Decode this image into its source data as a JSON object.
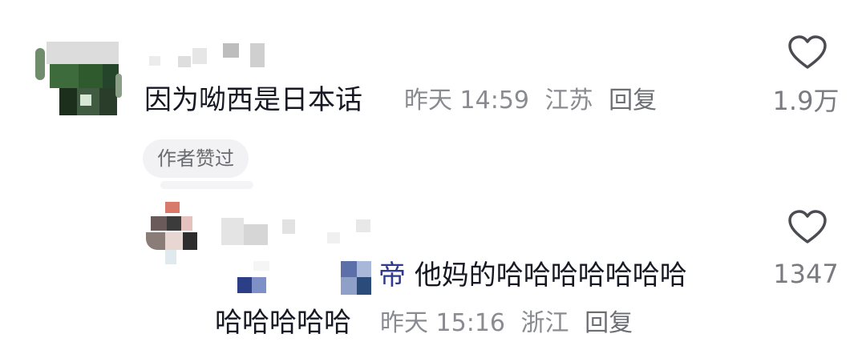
{
  "comments": [
    {
      "text": "因为呦西是日本话",
      "time": "昨天 14:59",
      "location": "江苏",
      "reply_label": "回复",
      "like_count": "1.9万",
      "badge": "作者赞过"
    }
  ],
  "reply": {
    "emoji_char": "帝",
    "text_line1": "他妈的哈哈哈哈哈哈哈",
    "text_line2": "哈哈哈哈哈",
    "time": "昨天 15:16",
    "location": "浙江",
    "reply_label": "回复",
    "like_count": "1347"
  },
  "icons": {
    "like": "heart-outline-icon"
  },
  "colors": {
    "meta_gray": "#8a8b91",
    "badge_bg": "#f2f2f4"
  }
}
